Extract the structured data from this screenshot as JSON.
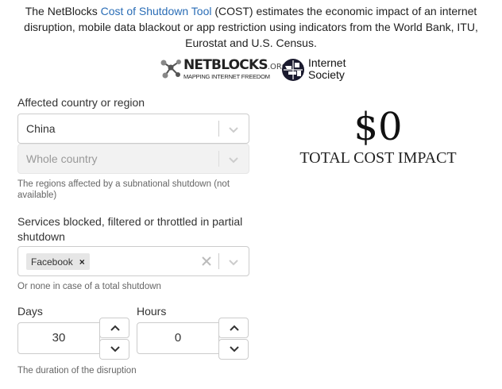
{
  "intro": {
    "before": "The NetBlocks ",
    "link": "Cost of Shutdown Tool",
    "after": " (COST) estimates the economic impact of an internet disruption, mobile data blackout or app restriction using indicators from the World Bank, ITU, Eurostat and U.S. Census."
  },
  "logos": {
    "netblocks": {
      "title": "NETBLOCKS",
      "tld": ".ORG",
      "tagline": "MAPPING INTERNET FREEDOM"
    },
    "isoc": {
      "line1": "Internet",
      "line2": "Society"
    }
  },
  "country": {
    "label": "Affected country or region",
    "value": "China"
  },
  "region": {
    "value": "Whole country",
    "help": "The regions affected by a subnational shutdown (not available)"
  },
  "services": {
    "label": "Services blocked, filtered or throttled in partial shutdown",
    "tags": [
      "Facebook"
    ],
    "remove_glyph": "×",
    "help": "Or none in case of a total shutdown"
  },
  "duration": {
    "days_label": "Days",
    "days_value": "30",
    "hours_label": "Hours",
    "hours_value": "0",
    "help": "The duration of the disruption"
  },
  "result": {
    "value": "$0",
    "label": "TOTAL COST IMPACT"
  },
  "colors": {
    "link": "#2a6db6",
    "border": "#cccccc",
    "disabled_bg": "#f2f2f2"
  }
}
